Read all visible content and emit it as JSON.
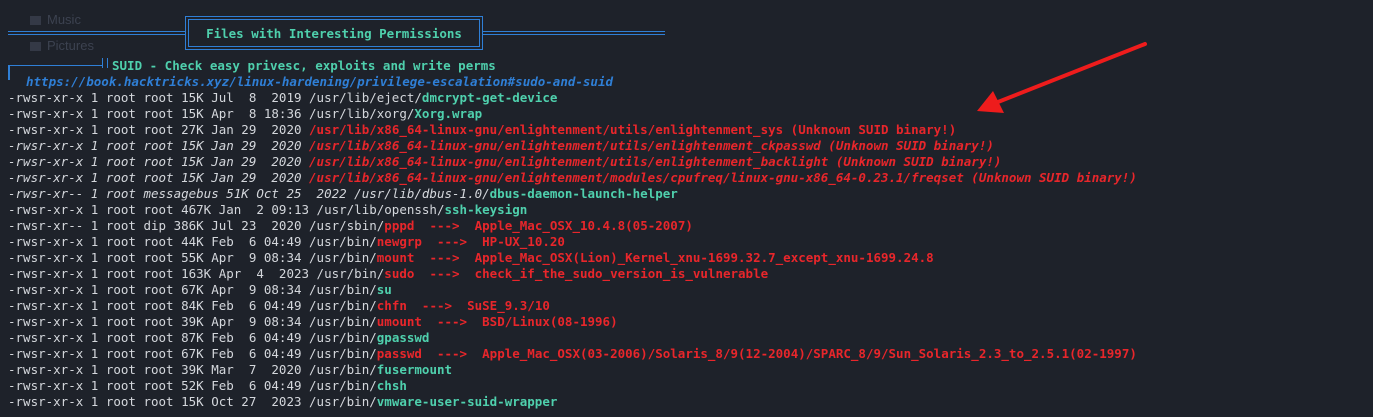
{
  "ghost_items": [
    "Music",
    "Pictures"
  ],
  "section_title": "Files with Interesting Permissions",
  "suid_header": "SUID - Check easy privesc, exploits and write perms",
  "link": "https://book.hacktricks.xyz/linux-hardening/privilege-escalation#sudo-and-suid",
  "colors": {
    "background": "#1e222a",
    "text": "#d4d7dc",
    "accent_cyan": "#4fd0ad",
    "accent_blue": "#2f7fd6",
    "alert_red": "#e8262b"
  },
  "annotation": "red-arrow-icon",
  "rows": [
    {
      "segs": [
        {
          "t": "-rwsr-xr-x 1 root root 15K Jul  8  2019 /usr/lib/eject/",
          "s": "plain"
        },
        {
          "t": "dmcrypt-get-device",
          "s": "cyan"
        }
      ]
    },
    {
      "segs": [
        {
          "t": "-rwsr-xr-x 1 root root 15K Apr  8 18:36 /usr/lib/xorg/",
          "s": "plain"
        },
        {
          "t": "Xorg.wrap",
          "s": "cyan"
        }
      ]
    },
    {
      "segs": [
        {
          "t": "-rwsr-xr-x 1 root root 27K Jan 29  2020 ",
          "s": "plain"
        },
        {
          "t": "/usr/lib/x86_64-linux-gnu/enlightenment/utils/enlightenment_sys (Unknown SUID binary!)",
          "s": "red"
        }
      ]
    },
    {
      "segs": [
        {
          "t": "-rwsr-xr-x 1 root root 15K Jan 29  2020 ",
          "s": "plainit"
        },
        {
          "t": "/usr/lib/x86_64-linux-gnu/enlightenment/utils/enlightenment_ckpasswd (Unknown SUID binary!)",
          "s": "redit"
        }
      ]
    },
    {
      "segs": [
        {
          "t": "-rwsr-xr-x 1 root root 15K Jan 29  2020 ",
          "s": "plainit"
        },
        {
          "t": "/usr/lib/x86_64-linux-gnu/enlightenment/utils/enlightenment_backlight (Unknown SUID binary!)",
          "s": "redit"
        }
      ]
    },
    {
      "segs": [
        {
          "t": "-rwsr-xr-x 1 root root 15K Jan 29  2020 ",
          "s": "plainit"
        },
        {
          "t": "/usr/lib/x86_64-linux-gnu/enlightenment/modules/cpufreq/linux-gnu-x86_64-0.23.1/freqset (Unknown SUID binary!)",
          "s": "redit"
        }
      ]
    },
    {
      "segs": [
        {
          "t": "-rwsr-xr-- 1 root messagebus 51K Oct 25  2022 /usr/lib/dbus-1.0/",
          "s": "plainit"
        },
        {
          "t": "dbus-daemon-launch-helper",
          "s": "cyan"
        }
      ]
    },
    {
      "segs": [
        {
          "t": "-rwsr-xr-x 1 root root 467K Jan  2 09:13 /usr/lib/openssh/",
          "s": "plain"
        },
        {
          "t": "ssh-keysign",
          "s": "cyan"
        }
      ]
    },
    {
      "segs": [
        {
          "t": "-rwsr-xr-- 1 root dip 386K Jul 23  2020 /usr/sbin/",
          "s": "plain"
        },
        {
          "t": "pppd",
          "s": "red"
        },
        {
          "t": "  --->  ",
          "s": "warn"
        },
        {
          "t": "Apple_Mac_OSX_10.4.8(05-2007)",
          "s": "warn"
        }
      ]
    },
    {
      "segs": [
        {
          "t": "-rwsr-xr-x 1 root root 44K Feb  6 04:49 /usr/bin/",
          "s": "plain"
        },
        {
          "t": "newgrp",
          "s": "red"
        },
        {
          "t": "  --->  ",
          "s": "warn"
        },
        {
          "t": "HP-UX_10.20",
          "s": "warn"
        }
      ]
    },
    {
      "segs": [
        {
          "t": "-rwsr-xr-x 1 root root 55K Apr  9 08:34 /usr/bin/",
          "s": "plain"
        },
        {
          "t": "mount",
          "s": "red"
        },
        {
          "t": "  --->  ",
          "s": "warn"
        },
        {
          "t": "Apple_Mac_OSX(Lion)_Kernel_xnu-1699.32.7_except_xnu-1699.24.8",
          "s": "warn"
        }
      ]
    },
    {
      "segs": [
        {
          "t": "-rwsr-xr-x 1 root root 163K Apr  4  2023 /usr/bin/",
          "s": "plain"
        },
        {
          "t": "sudo",
          "s": "red"
        },
        {
          "t": "  --->  ",
          "s": "warn"
        },
        {
          "t": "check_if_the_sudo_version_is_vulnerable",
          "s": "warn"
        }
      ]
    },
    {
      "segs": [
        {
          "t": "-rwsr-xr-x 1 root root 67K Apr  9 08:34 /usr/bin/",
          "s": "plain"
        },
        {
          "t": "su",
          "s": "cyan"
        }
      ]
    },
    {
      "segs": [
        {
          "t": "-rwsr-xr-x 1 root root 84K Feb  6 04:49 /usr/bin/",
          "s": "plain"
        },
        {
          "t": "chfn",
          "s": "red"
        },
        {
          "t": "  --->  ",
          "s": "warn"
        },
        {
          "t": "SuSE_9.3/10",
          "s": "warn"
        }
      ]
    },
    {
      "segs": [
        {
          "t": "-rwsr-xr-x 1 root root 39K Apr  9 08:34 /usr/bin/",
          "s": "plain"
        },
        {
          "t": "umount",
          "s": "red"
        },
        {
          "t": "  --->  ",
          "s": "warn"
        },
        {
          "t": "BSD/Linux(08-1996)",
          "s": "warn"
        }
      ]
    },
    {
      "segs": [
        {
          "t": "-rwsr-xr-x 1 root root 87K Feb  6 04:49 /usr/bin/",
          "s": "plain"
        },
        {
          "t": "gpasswd",
          "s": "cyan"
        }
      ]
    },
    {
      "segs": [
        {
          "t": "-rwsr-xr-x 1 root root 67K Feb  6 04:49 /usr/bin/",
          "s": "plain"
        },
        {
          "t": "passwd",
          "s": "red"
        },
        {
          "t": "  --->  ",
          "s": "warn"
        },
        {
          "t": "Apple_Mac_OSX(03-2006)/Solaris_8/9(12-2004)/SPARC_8/9/Sun_Solaris_2.3_to_2.5.1(02-1997)",
          "s": "warn"
        }
      ]
    },
    {
      "segs": [
        {
          "t": "-rwsr-xr-x 1 root root 39K Mar  7  2020 /usr/bin/",
          "s": "plain"
        },
        {
          "t": "fusermount",
          "s": "cyan"
        }
      ]
    },
    {
      "segs": [
        {
          "t": "-rwsr-xr-x 1 root root 52K Feb  6 04:49 /usr/bin/",
          "s": "plain"
        },
        {
          "t": "chsh",
          "s": "cyan"
        }
      ]
    },
    {
      "segs": [
        {
          "t": "-rwsr-xr-x 1 root root 15K Oct 27  2023 /usr/bin/",
          "s": "plain"
        },
        {
          "t": "vmware-user-suid-wrapper",
          "s": "cyan"
        }
      ]
    }
  ]
}
